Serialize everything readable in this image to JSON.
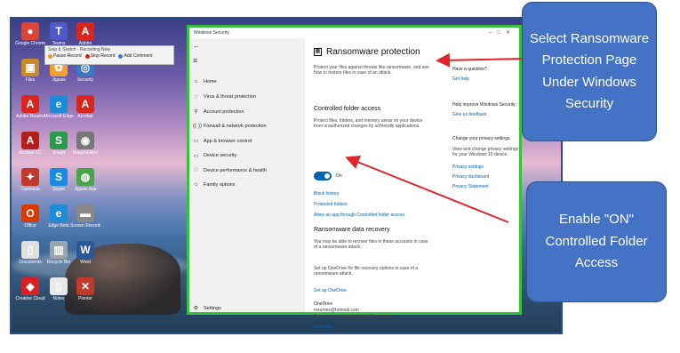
{
  "desktop_icons": [
    {
      "label": "Google Chrome",
      "glyph": "●",
      "color": "#db4437"
    },
    {
      "label": "Teams",
      "glyph": "T",
      "color": "#5059c9"
    },
    {
      "label": "Adobe",
      "glyph": "A",
      "color": "#d9251c"
    },
    {
      "label": "Files",
      "glyph": "▣",
      "color": "#c68b2c"
    },
    {
      "label": "Jigsaw",
      "glyph": "✿",
      "color": "#f0a030"
    },
    {
      "label": "Security",
      "glyph": "◎",
      "color": "#3a78c4"
    },
    {
      "label": "Adobe Reader",
      "glyph": "A",
      "color": "#d9251c"
    },
    {
      "label": "Microsoft Edge",
      "glyph": "e",
      "color": "#1f8ad6"
    },
    {
      "label": "Acrobat",
      "glyph": "A",
      "color": "#d9251c"
    },
    {
      "label": "Acrobat DC",
      "glyph": "A",
      "color": "#b3201a"
    },
    {
      "label": "Snagit",
      "glyph": "S",
      "color": "#2b9b4b"
    },
    {
      "label": "Snagit Editor",
      "glyph": "◉",
      "color": "#777"
    },
    {
      "label": "Camtasia",
      "glyph": "✦",
      "color": "#c0392b"
    },
    {
      "label": "Skype",
      "glyph": "S",
      "color": "#1a8be0"
    },
    {
      "label": "Jigsaw App",
      "glyph": "◍",
      "color": "#4aa34a"
    },
    {
      "label": "Office",
      "glyph": "O",
      "color": "#d83b01"
    },
    {
      "label": "Edge Beta",
      "glyph": "e",
      "color": "#1f8ad6"
    },
    {
      "label": "Screen Recorder",
      "glyph": "▬",
      "color": "#888"
    },
    {
      "label": "Documents",
      "glyph": "▯",
      "color": "#e0e0e0"
    },
    {
      "label": "Recycle Bin",
      "glyph": "▥",
      "color": "#9aa4ad"
    },
    {
      "label": "Word",
      "glyph": "W",
      "color": "#2b579a"
    },
    {
      "label": "Creative Cloud",
      "glyph": "◆",
      "color": "#da1f26"
    },
    {
      "label": "Notes",
      "glyph": "▯",
      "color": "#e8e8e8"
    },
    {
      "label": "Pointer",
      "glyph": "✕",
      "color": "#c0392b"
    }
  ],
  "snip": {
    "title": "Snip & Sketch - Recording Now",
    "pause": "Pause Record",
    "stop": "Stop Record",
    "add_comment": "Add Comment"
  },
  "window": {
    "title": "Windows Security",
    "nav": [
      {
        "label": "Home",
        "icon": "⌂"
      },
      {
        "label": "Virus & threat protection",
        "icon": "♡"
      },
      {
        "label": "Account protection",
        "icon": "⚲"
      },
      {
        "label": "Firewall & network protection",
        "icon": "((·))"
      },
      {
        "label": "App & browser control",
        "icon": "▭"
      },
      {
        "label": "Device security",
        "icon": "▭"
      },
      {
        "label": "Device performance & health",
        "icon": "♡"
      },
      {
        "label": "Family options",
        "icon": "☺"
      }
    ],
    "settings": "Settings",
    "heading": "Ransomware protection",
    "intro": "Protect your files against threats like ransomware, and see how to restore files in case of an attack.",
    "cfa_title": "Controlled folder access",
    "cfa_desc": "Protect files, folders, and memory areas on your device from unauthorized changes by unfriendly applications.",
    "toggle_state": "On",
    "links": [
      "Block history",
      "Protected folders",
      "Allow an app through Controlled folder access"
    ],
    "recovery_title": "Ransomware data recovery",
    "recovery_desc": "You may be able to recover files in these accounts in case of a ransomware attack.",
    "onedrive_setup": "Set up OneDrive for file recovery options in case of a ransomware attack.",
    "setup_link": "Set up OneDrive",
    "onedrive_label": "OneDrive",
    "email": "msumes@hotmail.com",
    "free_account": "Free account with individual file recovery.",
    "view_files": "View files",
    "right_panel": {
      "question": "Have a question?",
      "get_help": "Get help",
      "improve": "Help improve Windows Security",
      "feedback": "Give us feedback",
      "privacy": "Change your privacy settings",
      "privacy_desc": "View and change privacy settings for your Windows 10 device.",
      "privacy_links": [
        "Privacy settings",
        "Privacy dashboard",
        "Privacy Statement"
      ]
    }
  },
  "callouts": {
    "first": "Select Ransomware Protection Page Under Windows Security",
    "second": "Enable \"ON\" Controlled Folder Access"
  },
  "colors": {
    "frame": "#2c4f8a",
    "window_border": "#36c23a",
    "callout_fill": "#4472c4",
    "arrow": "#e0242b",
    "link": "#0063b1"
  }
}
